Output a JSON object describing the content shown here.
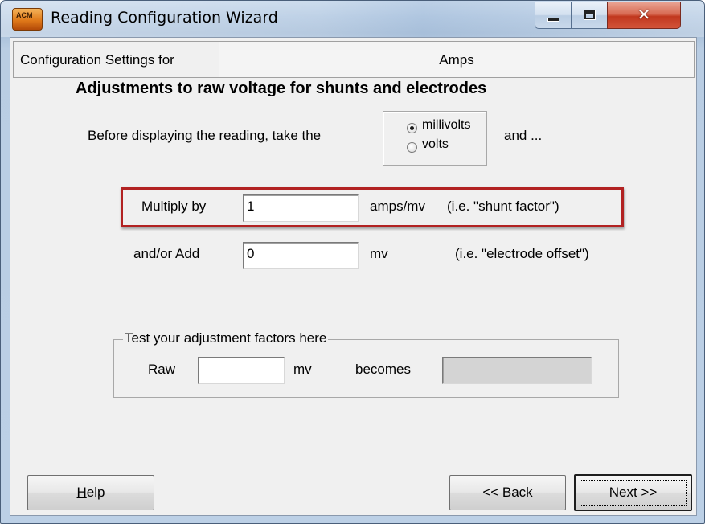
{
  "window": {
    "title": "Reading Configuration Wizard",
    "icon": "app-logo-icon",
    "icon_text": "ACM",
    "close_glyph": "✕"
  },
  "header": {
    "label": "Configuration Settings for",
    "value": "Amps"
  },
  "section": {
    "heading": "Adjustments to raw voltage for shunts and electrodes",
    "prefix_text": "Before displaying the reading, take the",
    "suffix_text": "and ...",
    "unit_options": [
      {
        "label": "millivolts",
        "checked": true
      },
      {
        "label": "volts",
        "checked": false
      }
    ]
  },
  "multiply": {
    "label": "Multiply by",
    "value": "1",
    "unit": "amps/mv",
    "note": "(i.e. \"shunt factor\")"
  },
  "add": {
    "label": "and/or Add",
    "value": "0",
    "unit": "mv",
    "note": "(i.e. \"electrode offset\")"
  },
  "test": {
    "title": "Test your adjustment factors here",
    "raw_label": "Raw",
    "raw_value": "",
    "raw_unit": "mv",
    "becomes_label": "becomes",
    "result_value": ""
  },
  "buttons": {
    "help_mnemonic": "H",
    "help_rest": "elp",
    "back": "<< Back",
    "next": "Next >>"
  },
  "colors": {
    "highlight_border": "#b22222",
    "close_button": "#c1371e"
  }
}
